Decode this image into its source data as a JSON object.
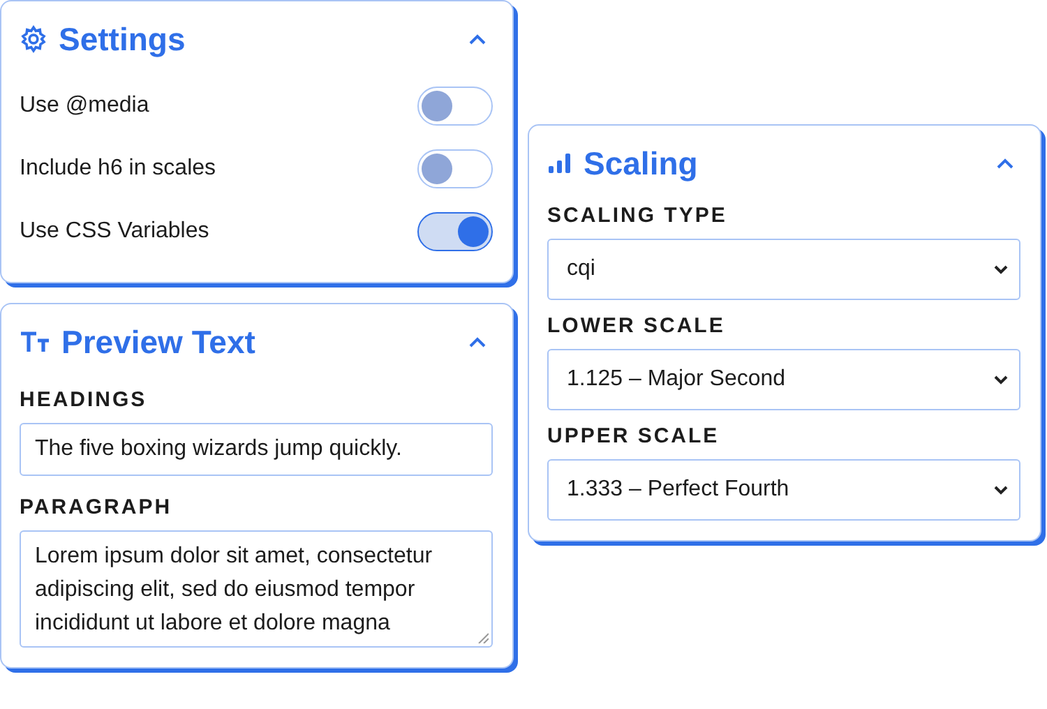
{
  "settings": {
    "title": "Settings",
    "expanded": true,
    "toggles": [
      {
        "label": "Use @media",
        "on": false
      },
      {
        "label": "Include h6 in scales",
        "on": false
      },
      {
        "label": "Use CSS Variables",
        "on": true
      }
    ]
  },
  "preview": {
    "title": "Preview Text",
    "expanded": true,
    "headings_label": "HEADINGS",
    "headings_value": "The five boxing wizards jump quickly.",
    "paragraph_label": "PARAGRAPH",
    "paragraph_value": "Lorem ipsum dolor sit amet, consectetur adipiscing elit, sed do eiusmod tempor incididunt ut labore et dolore magna"
  },
  "scaling": {
    "title": "Scaling",
    "expanded": true,
    "fields": [
      {
        "label": "SCALING TYPE",
        "value": "cqi"
      },
      {
        "label": "LOWER SCALE",
        "value": "1.125 – Major Second"
      },
      {
        "label": "UPPER SCALE",
        "value": "1.333 – Perfect Fourth"
      }
    ]
  }
}
